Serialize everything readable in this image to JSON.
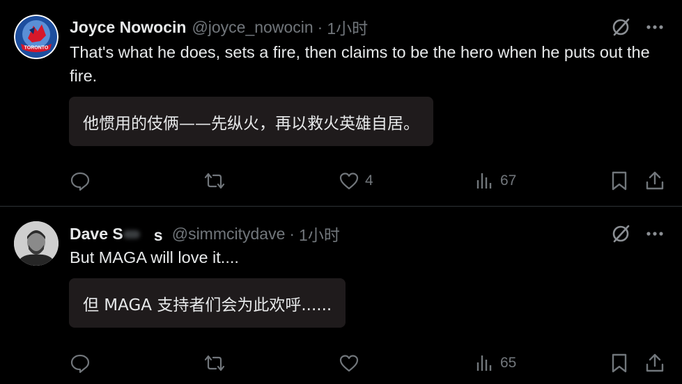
{
  "tweets": [
    {
      "name": "Joyce Nowocin",
      "handle": "@joyce_nowocin",
      "separator": "·",
      "time": "1小时",
      "avatar_text": "TORONTO",
      "text": "That's what he does, sets a fire, then claims to be the hero when he puts out the fire.",
      "translation": "他惯用的伎俩——先纵火，再以救火英雄自居。",
      "stats": {
        "replies": "",
        "retweets": "",
        "likes": "4",
        "views": "67"
      }
    },
    {
      "name": "Dave S",
      "name_tail": "s",
      "handle": "@simmcitydave",
      "separator": "·",
      "time": "1小时",
      "text": "But MAGA will love it....",
      "translation": "但 MAGA 支持者们会为此欢呼......",
      "stats": {
        "replies": "",
        "retweets": "",
        "likes": "",
        "views": "65"
      }
    }
  ],
  "icons": {
    "grok": "grok-icon",
    "more": "more-icon",
    "reply": "reply-icon",
    "retweet": "retweet-icon",
    "like": "heart-icon",
    "views": "views-icon",
    "bookmark": "bookmark-icon",
    "share": "share-icon"
  },
  "colors": {
    "background": "#000000",
    "text": "#e7e9ea",
    "muted": "#71767b",
    "translation_bg": "#1f1b1c",
    "divider": "#2f3336",
    "avatar1_ring": "#1d4e9e",
    "avatar1_accent": "#d7182a"
  }
}
